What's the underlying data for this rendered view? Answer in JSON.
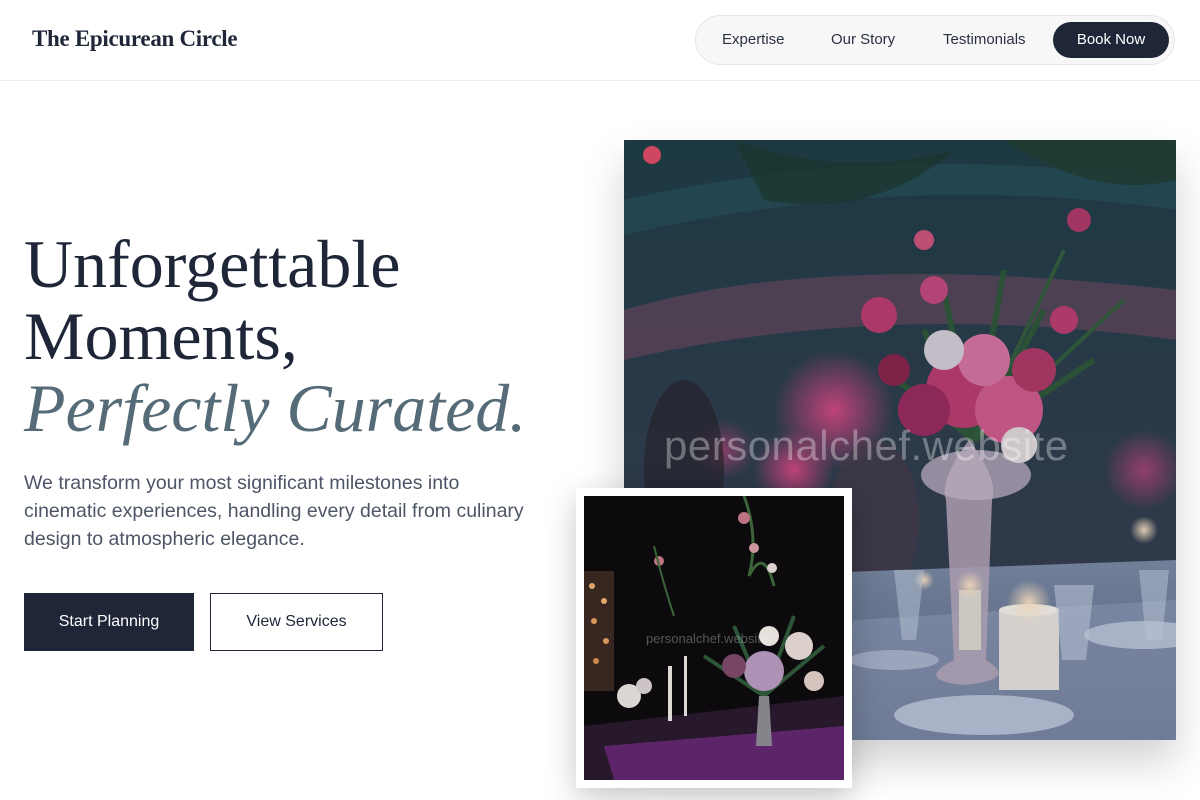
{
  "brand": {
    "name": "The Epicurean Circle"
  },
  "nav": {
    "links": [
      "Expertise",
      "Our Story",
      "Testimonials"
    ],
    "cta": "Book Now"
  },
  "hero": {
    "headline_line1": "Unforgettable",
    "headline_line2": "Moments,",
    "headline_accent": "Perfectly Curated.",
    "description": "We transform your most significant milestones into cinematic experiences, handling every detail from culinary design to atmospheric elegance.",
    "primary_cta": "Start Planning",
    "secondary_cta": "View Services"
  },
  "images": {
    "main_watermark": "personalchef.website",
    "inset_watermark": "personalchef.website"
  },
  "colors": {
    "navy": "#1e2638",
    "accent_slate": "#566b78",
    "body_text": "#4d5566"
  }
}
